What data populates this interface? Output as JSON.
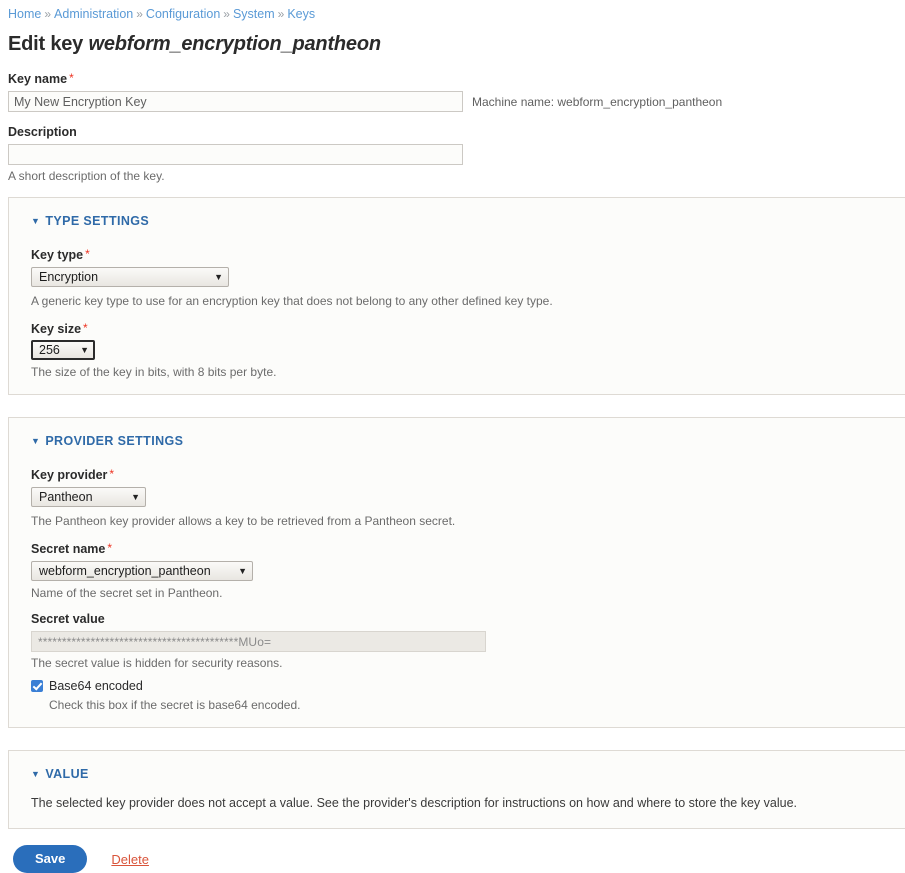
{
  "breadcrumb": {
    "separator": "»",
    "items": [
      {
        "label": "Home"
      },
      {
        "label": "Administration"
      },
      {
        "label": "Configuration"
      },
      {
        "label": "System"
      },
      {
        "label": "Keys"
      }
    ]
  },
  "page": {
    "title_prefix": "Edit key",
    "title_key": "webform_encryption_pantheon"
  },
  "form": {
    "key_name": {
      "label": "Key name",
      "required_mark": "*",
      "value": "My New Encryption Key",
      "machine_name": "Machine name: webform_encryption_pantheon"
    },
    "description": {
      "label": "Description",
      "value": "",
      "help": "A short description of the key."
    }
  },
  "type_settings": {
    "title": "TYPE SETTINGS",
    "toggle_icon": "▼",
    "key_type": {
      "label": "Key type",
      "required_mark": "*",
      "value": "Encryption",
      "caret": "▼",
      "help": "A generic key type to use for an encryption key that does not belong to any other defined key type."
    },
    "key_size": {
      "label": "Key size",
      "required_mark": "*",
      "value": "256",
      "caret": "▼",
      "help": "The size of the key in bits, with 8 bits per byte."
    }
  },
  "provider_settings": {
    "title": "PROVIDER SETTINGS",
    "toggle_icon": "▼",
    "key_provider": {
      "label": "Key provider",
      "required_mark": "*",
      "value": "Pantheon",
      "caret": "▼",
      "help": "The Pantheon key provider allows a key to be retrieved from a Pantheon secret."
    },
    "secret_name": {
      "label": "Secret name",
      "required_mark": "*",
      "value": "webform_encryption_pantheon",
      "caret": "▼",
      "help": "Name of the secret set in Pantheon."
    },
    "secret_value": {
      "label": "Secret value",
      "value": "******************************************MUo=",
      "help": "The secret value is hidden for security reasons."
    },
    "base64": {
      "label": "Base64 encoded",
      "checked": true,
      "help": "Check this box if the secret is base64 encoded."
    }
  },
  "value_section": {
    "title": "VALUE",
    "toggle_icon": "▼",
    "text": "The selected key provider does not accept a value. See the provider's description for instructions on how and where to store the key value."
  },
  "actions": {
    "save_label": "Save",
    "delete_label": "Delete"
  },
  "colors": {
    "link": "#5a9ad6",
    "panel_title": "#2f6aa8",
    "required": "#ee3322",
    "save_bg": "#2a6ebb",
    "delete": "#d9543a",
    "checkbox": "#3a7fd5"
  }
}
